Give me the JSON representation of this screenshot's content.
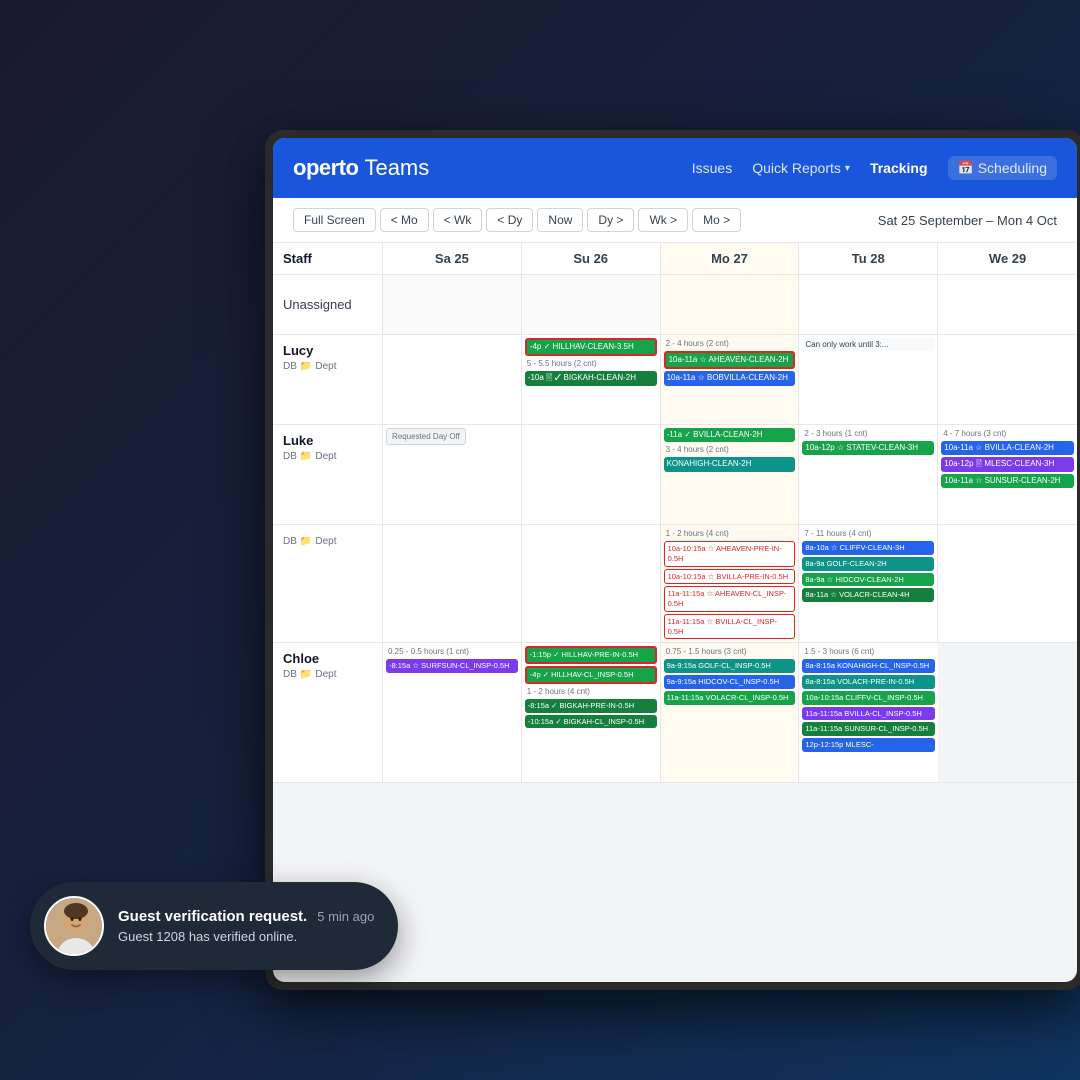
{
  "app": {
    "logo": "operto",
    "appName": "Teams"
  },
  "nav": {
    "items": [
      {
        "label": "Issues",
        "active": false
      },
      {
        "label": "Quick Reports",
        "active": false,
        "hasDropdown": true
      },
      {
        "label": "Tracking",
        "active": true
      },
      {
        "label": "Scheduling",
        "active": false,
        "hasIcon": true
      }
    ]
  },
  "toolbar": {
    "buttons": [
      "Full Screen",
      "< Mo",
      "< Wk",
      "< Dy",
      "Now",
      "Dy >",
      "Wk >",
      "Mo >"
    ],
    "dateRange": "Sat 25 September – Mon 4 Oct"
  },
  "calendar": {
    "columns": [
      {
        "label": "Staff"
      },
      {
        "label": "Sa 25"
      },
      {
        "label": "Su 26"
      },
      {
        "label": "Mo 27"
      },
      {
        "label": "Tu 28"
      },
      {
        "label": "We 29"
      }
    ],
    "rows": [
      {
        "staff": {
          "name": "Unassigned",
          "dept": ""
        },
        "days": [
          {
            "type": "empty"
          },
          {
            "type": "empty"
          },
          {
            "type": "highlight"
          },
          {
            "type": "empty"
          },
          {
            "type": "empty"
          }
        ]
      },
      {
        "staff": {
          "name": "Lucy",
          "dept": "DB  Dept"
        },
        "days": [
          {
            "type": "empty"
          },
          {
            "events": [
              {
                "color": "red-border",
                "text": "-4p ✓ HILLHAV-CLEAN-3.5H"
              },
              {
                "color": "text-only",
                "text": "5 - 5.5 hours (2 cnt)"
              },
              {
                "color": "dark-green",
                "text": "-10a 🖹 ✓ BIGKAH-CLEAN-2H"
              }
            ]
          },
          {
            "events": [
              {
                "color": "text-only",
                "text": "2 - 4 hours (2 cnt)"
              },
              {
                "color": "red-border",
                "text": "10a-11a ☆ AHEAVEN-CLEAN-2H"
              },
              {
                "color": "blue",
                "text": "10a-11a ☆ BOBVILLA-CLEAN-2H"
              }
            ]
          },
          {
            "events": [
              {
                "color": "text-only",
                "text": "Can only work until 3:"
              }
            ]
          },
          {
            "type": "empty"
          }
        ]
      },
      {
        "staff": {
          "name": "Luke",
          "dept": "DB  Dept"
        },
        "days": [
          {
            "events": [
              {
                "color": "requested-off",
                "text": "Requested Day Off"
              }
            ]
          },
          {
            "type": "empty"
          },
          {
            "events": [
              {
                "color": "green",
                "text": "-11a ✓ BVILLA-CLEAN-2H"
              },
              {
                "color": "text-only",
                "text": "3 - 4 hours (2 cnt)"
              },
              {
                "color": "teal",
                "text": "KONAHIGH-CLEAN-2H"
              }
            ]
          },
          {
            "events": [
              {
                "color": "text-only",
                "text": "2 - 3 hours (1 cnt)"
              },
              {
                "color": "green",
                "text": "10a-12p ☆ STATEV-CLEAN-3H"
              }
            ]
          },
          {
            "events": [
              {
                "color": "text-only",
                "text": "4 - 7 hours (3 cnt)"
              },
              {
                "color": "blue",
                "text": "10a-11a ☆ BVILLA-CLEAN-2H"
              },
              {
                "color": "purple",
                "text": "10a-12p 🖹 MLESC-CLEAN-3H"
              },
              {
                "color": "green",
                "text": "10a-11a ☆ SUNSUR-CLEAN-2H"
              }
            ]
          }
        ]
      },
      {
        "staff": {
          "name": "",
          "dept": "DB  Dept"
        },
        "days": [
          {
            "type": "empty"
          },
          {
            "type": "empty"
          },
          {
            "events": [
              {
                "color": "text-only",
                "text": "1 - 2 hours (4 cnt)"
              },
              {
                "color": "red-outline",
                "text": "10a-10:15a ☆ AHEAVEN-PRE-IN-0.5H"
              },
              {
                "color": "red-outline",
                "text": "10a-10:15a ☆ BVILLA-PRE-IN-0.5H"
              },
              {
                "color": "red-outline",
                "text": "11a-11:15a ☆ AHEAVEN-CL_INSP-0.5H"
              },
              {
                "color": "red-outline",
                "text": "11a-11:15a ☆ BVILLA-CL_INSP-0.5H"
              }
            ]
          },
          {
            "events": [
              {
                "color": "text-only",
                "text": "7 - 11 hours (4 cnt)"
              },
              {
                "color": "blue",
                "text": "8a-10a ☆ CLIFFV-CLEAN-3H"
              },
              {
                "color": "teal",
                "text": "8a-9a GOLF-CLEAN-2H"
              },
              {
                "color": "green",
                "text": "8a-9a ☆ HIDCOV-CLEAN-2H"
              },
              {
                "color": "dark-green",
                "text": "8a-11a ☆ VOLACR-CLEAN-4H"
              }
            ]
          },
          {
            "type": "empty"
          }
        ]
      },
      {
        "staff": {
          "name": "Chloe",
          "dept": "DB  Dept"
        },
        "days": [
          {
            "events": [
              {
                "color": "text-only",
                "text": "0.25 - 0.5 hours (1 cnt)"
              },
              {
                "color": "purple",
                "text": "-8:15a ☆ SURFSUN-CL_INSP-0.5H"
              }
            ]
          },
          {
            "events": [
              {
                "color": "red-border-green",
                "text": "-1:15p ✓ HILLHAV-PRE-IN-0.5H"
              },
              {
                "color": "red-border-green",
                "text": "-4p ✓ HILLHAV-CL_INSP-0.5H"
              },
              {
                "color": "text-only",
                "text": "1 - 2 hours (4 cnt)"
              },
              {
                "color": "dark-green",
                "text": "-8:15a ✓ BIGKAH-PRE-IN-0.5H"
              },
              {
                "color": "dark-green",
                "text": "-10:15a ✓ BIGKAH-CL_INSP-0.5H"
              }
            ]
          },
          {
            "events": [
              {
                "color": "text-only",
                "text": "0.75 - 1.5 hours (3 cnt)"
              },
              {
                "color": "teal",
                "text": "9a-9:15a GOLF-CL_INSP-0.5H"
              },
              {
                "color": "blue",
                "text": "9a-9:15a HIDCOV-CL_INSP-0.5H"
              },
              {
                "color": "green",
                "text": "11a-11:15a VOLACR-CL_INSP-0.5H"
              }
            ]
          },
          {
            "events": [
              {
                "color": "text-only",
                "text": "1.5 - 3 hours (6 cnt)"
              },
              {
                "color": "blue",
                "text": "8a-8:15a KONAHIGH-CL_INSP-0.5H"
              },
              {
                "color": "teal",
                "text": "8a-8:15a VOLACR-PRE-IN-0.5H"
              },
              {
                "color": "green",
                "text": "10a-10:15a CLIFFV-CL_INSP-0.5H"
              },
              {
                "color": "purple",
                "text": "11a-11:15a BVILLA-CL_INSP-0.5H"
              },
              {
                "color": "dark-green",
                "text": "11a-11:15a SUNSUR-CL_INSP-0.5H"
              },
              {
                "color": "blue",
                "text": "12p-12:15p MLESC-"
              }
            ]
          }
        ]
      }
    ]
  },
  "toast": {
    "title": "Guest verification request.",
    "time": "5 min ago",
    "body": "Guest 1208 has verified online."
  }
}
